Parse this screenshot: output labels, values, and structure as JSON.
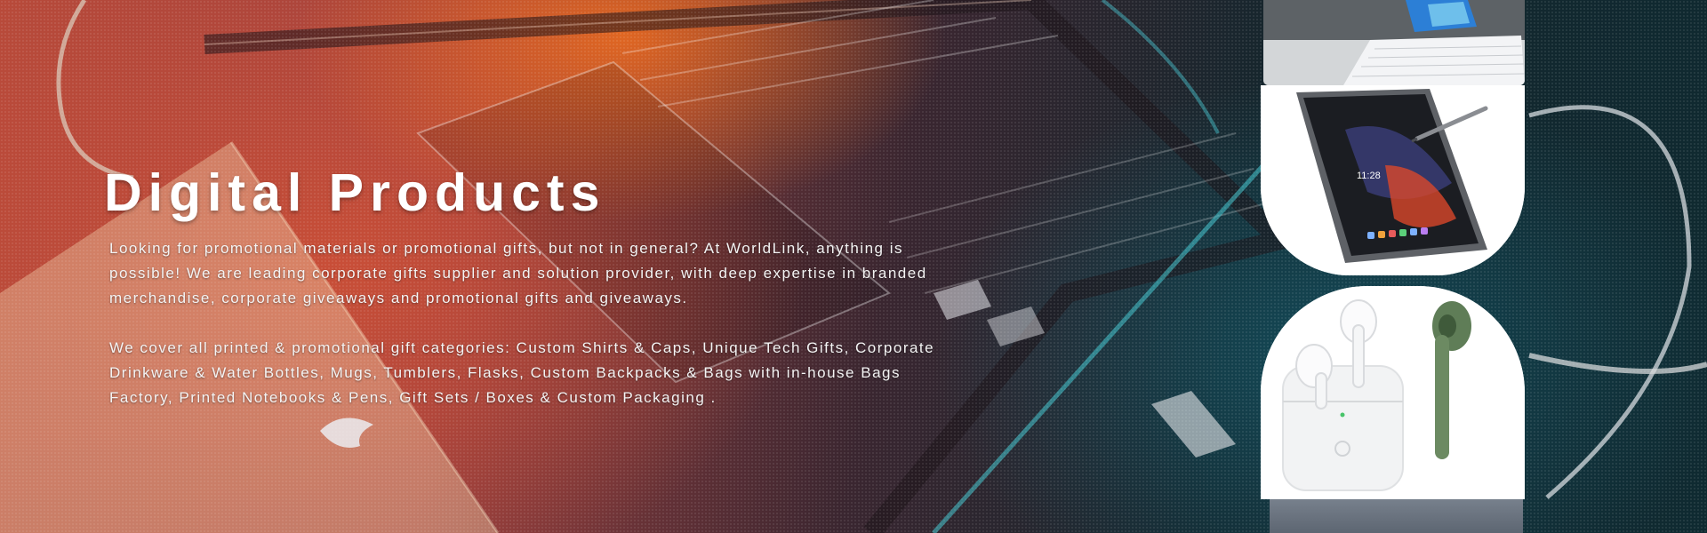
{
  "hero": {
    "title": "Digital Products",
    "paragraphs": [
      "Looking for promotional materials or promotional gifts, but not in general? At WorldLink, anything is possible! We are leading corporate gifts supplier and solution provider, with deep expertise in branded merchandise, corporate giveaways and promotional gifts and giveaways.",
      "We cover all printed & promotional gift categories: Custom Shirts & Caps, Unique Tech Gifts, Corporate Drinkware & Water Bottles, Mugs, Tumblers, Flasks, Custom Backpacks & Bags with in-house Bags Factory, Printed Notebooks & Pens, Gift Sets / Boxes & Custom Packaging ."
    ]
  },
  "gallery": {
    "items": [
      {
        "name": "laptop-image"
      },
      {
        "name": "tablet-image",
        "screen_time": "11:28"
      },
      {
        "name": "earbuds-image"
      },
      {
        "name": "wood-texture-image"
      }
    ]
  }
}
